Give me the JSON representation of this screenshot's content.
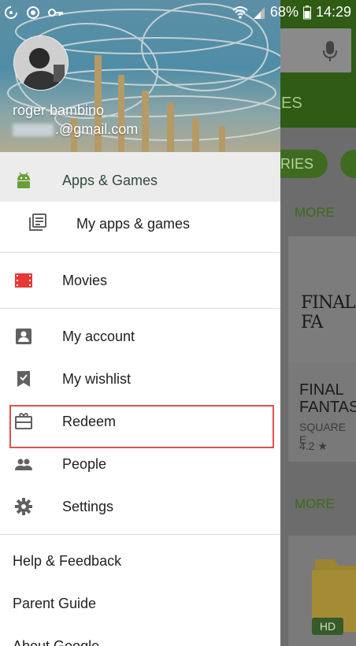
{
  "status_bar": {
    "battery": "68%",
    "time": "14:29"
  },
  "account": {
    "name": "roger bambino",
    "email_visible": ".@gmail.com"
  },
  "menu": {
    "apps_games": "Apps & Games",
    "my_apps": "My apps & games",
    "movies": "Movies",
    "my_account": "My account",
    "my_wishlist": "My wishlist",
    "redeem": "Redeem",
    "people": "People",
    "settings": "Settings",
    "help": "Help & Feedback",
    "parent_guide": "Parent Guide",
    "about": "About Google"
  },
  "background": {
    "tab_partial": "ES",
    "chip1": "ORIES",
    "more1": "MORE",
    "more2": "MORE",
    "card_title": "FINAL FANTAS",
    "card_sub": "SQUARE E",
    "card_rating": "4.2",
    "hd_badge": "HD"
  },
  "colors": {
    "brand_green": "#689f38",
    "movies_red": "#e53935",
    "highlight_border": "#d9534f"
  }
}
